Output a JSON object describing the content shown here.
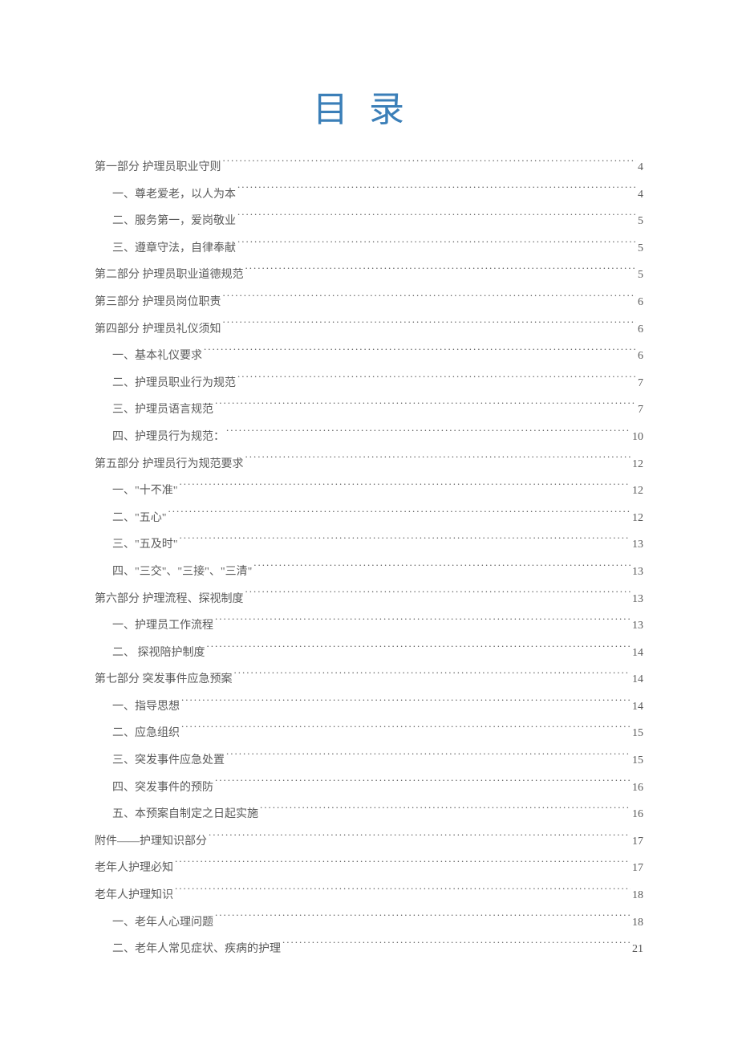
{
  "title": "目录",
  "toc": [
    {
      "level": 0,
      "label": "第一部分 护理员职业守则",
      "page": "4"
    },
    {
      "level": 1,
      "label": "一、尊老爱老，以人为本",
      "page": "4"
    },
    {
      "level": 1,
      "label": "二、服务第一，爱岗敬业",
      "page": "5"
    },
    {
      "level": 1,
      "label": "三、遵章守法，自律奉献",
      "page": "5"
    },
    {
      "level": 0,
      "label": "第二部分 护理员职业道德规范",
      "page": "5"
    },
    {
      "level": 0,
      "label": "第三部分 护理员岗位职责",
      "page": "6"
    },
    {
      "level": 0,
      "label": "第四部分 护理员礼仪须知",
      "page": "6"
    },
    {
      "level": 1,
      "label": "一、基本礼仪要求",
      "page": "6"
    },
    {
      "level": 1,
      "label": "二、护理员职业行为规范",
      "page": "7"
    },
    {
      "level": 1,
      "label": "三、护理员语言规范",
      "page": "7"
    },
    {
      "level": 1,
      "label": "四、护理员行为规范：",
      "page": "10"
    },
    {
      "level": 0,
      "label": "第五部分 护理员行为规范要求",
      "page": "12"
    },
    {
      "level": 1,
      "label": "一、\"十不准\"",
      "page": "12"
    },
    {
      "level": 1,
      "label": "二、\"五心\"",
      "page": "12"
    },
    {
      "level": 1,
      "label": "三、\"五及时\"",
      "page": "13"
    },
    {
      "level": 1,
      "label": "四、\"三交\"、\"三接\"、\"三清\"",
      "page": "13"
    },
    {
      "level": 0,
      "label": "第六部分 护理流程、探视制度",
      "page": "13"
    },
    {
      "level": 1,
      "label": "一、护理员工作流程",
      "page": "13"
    },
    {
      "level": 1,
      "label": "二、 探视陪护制度",
      "page": "14"
    },
    {
      "level": 0,
      "label": "第七部分 突发事件应急预案",
      "page": "14"
    },
    {
      "level": 1,
      "label": "一、指导思想",
      "page": "14"
    },
    {
      "level": 1,
      "label": "二、应急组织",
      "page": "15"
    },
    {
      "level": 1,
      "label": "三、突发事件应急处置",
      "page": "15"
    },
    {
      "level": 1,
      "label": "四、突发事件的预防",
      "page": "16"
    },
    {
      "level": 1,
      "label": "五、本预案自制定之日起实施",
      "page": "16"
    },
    {
      "level": 0,
      "label": "附件——护理知识部分",
      "page": "17"
    },
    {
      "level": 0,
      "label": "老年人护理必知",
      "page": "17"
    },
    {
      "level": 0,
      "label": "老年人护理知识",
      "page": "18"
    },
    {
      "level": 1,
      "label": "一、老年人心理问题",
      "page": "18"
    },
    {
      "level": 1,
      "label": "二、老年人常见症状、疾病的护理",
      "page": "21"
    }
  ]
}
